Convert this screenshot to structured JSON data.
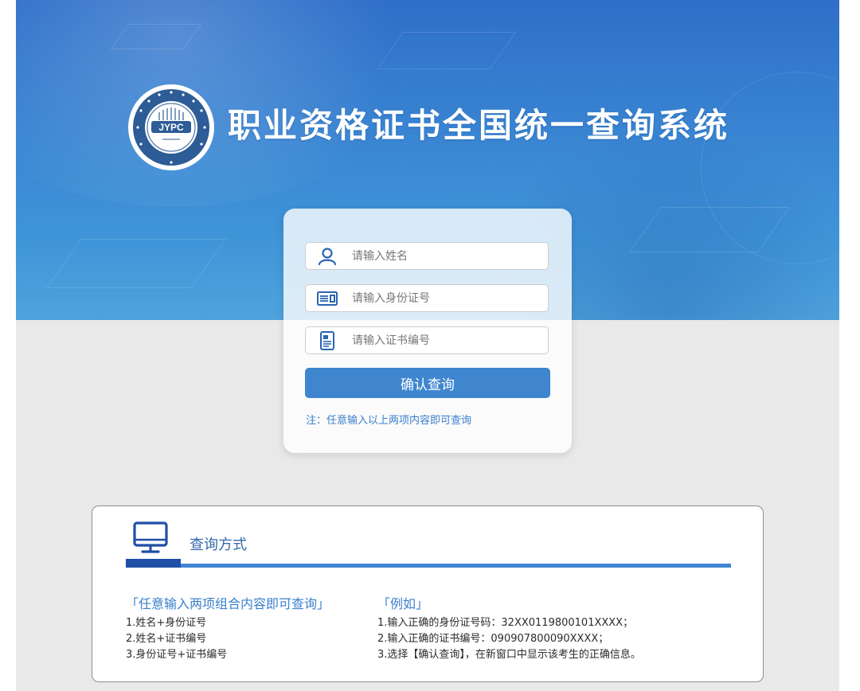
{
  "header": {
    "title": "职业资格证书全国统一查询系统",
    "logo": {
      "monogram": "JYPC"
    }
  },
  "query_form": {
    "name_field": {
      "placeholder": "请输入姓名",
      "value": "",
      "icon": "user-icon"
    },
    "id_field": {
      "placeholder": "请输入身份证号",
      "value": "",
      "icon": "id-card-icon"
    },
    "cert_field": {
      "placeholder": "请输入证书编号",
      "value": "",
      "icon": "certificate-icon"
    },
    "submit_label": "确认查询",
    "note": "注：任意输入以上两项内容即可查询"
  },
  "method_panel": {
    "title": "查询方式",
    "icon": "monitor-icon",
    "combinations": {
      "heading": "「任意输入两项组合内容即可查询」",
      "items": [
        "1.姓名+身份证号",
        "2.姓名+证书编号",
        "3.身份证号+证书编号"
      ]
    },
    "examples": {
      "heading": "「例如」",
      "items": [
        "1.输入正确的身份证号码：32XX0119800101XXXX；",
        "2.输入正确的证书编号：090907800090XXXX；",
        "3.选择【确认查询】，在新窗口中显示该考生的正确信息。"
      ]
    }
  },
  "colors": {
    "banner_blue": "#3a86d3",
    "button_blue": "#3f86cf",
    "accent_text": "#3a7fce",
    "page_gray": "#e9e9ea"
  }
}
